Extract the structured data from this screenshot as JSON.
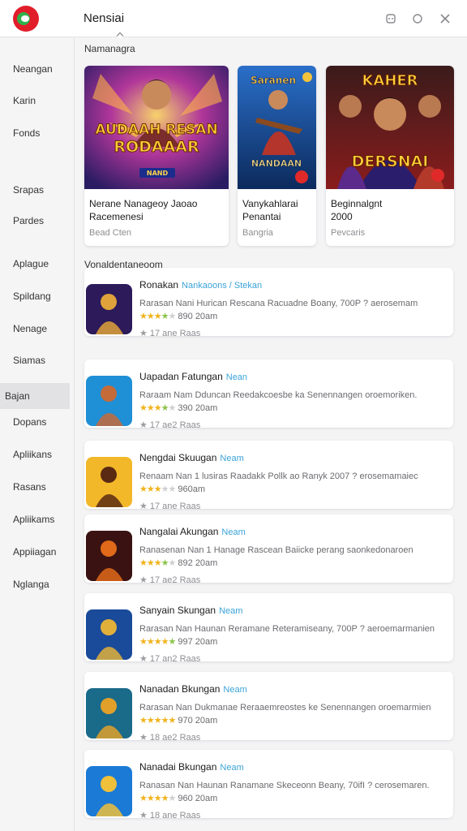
{
  "header": {
    "title": "Nensiai",
    "icons": [
      "gamepad-icon",
      "circle-icon",
      "close-icon"
    ]
  },
  "sidebar": {
    "items": [
      {
        "label": "Neangan",
        "active": false
      },
      {
        "label": "Karin",
        "active": false
      },
      {
        "label": "Fonds",
        "active": false
      },
      {
        "label": "Srapas",
        "active": false
      },
      {
        "label": "Pardes",
        "active": false
      },
      {
        "label": "Aplague",
        "active": false
      },
      {
        "label": "Spildang",
        "active": false
      },
      {
        "label": "Nenage",
        "active": false
      },
      {
        "label": "Siamas",
        "active": false
      },
      {
        "label": "Bajan",
        "active": true
      },
      {
        "label": "Dopans",
        "active": false
      },
      {
        "label": "Apliikans",
        "active": false
      },
      {
        "label": "Rasans",
        "active": false
      },
      {
        "label": "Apliikams",
        "active": false
      },
      {
        "label": "Appiiagan",
        "active": false
      },
      {
        "label": "Nglanga",
        "active": false
      }
    ]
  },
  "featured": {
    "section_label": "Namanagra",
    "cards": [
      {
        "art_text_1": "AUDAAH RESAN",
        "art_text_2": "RODAAAR",
        "art_badge": "NAND",
        "title_line1": "Nerane Nanageoy Jaoao",
        "title_line2": "Racemenesi",
        "category": "Bead Cten"
      },
      {
        "art_text_1": "Saranen",
        "art_text_2": "NANDAAN",
        "art_badge": "",
        "title_line1": "Vanykahlarai",
        "title_line2": "Penantai",
        "category": "Bangria"
      },
      {
        "art_text_1": "KAHER",
        "art_text_2": "DERSNAI",
        "art_badge": "",
        "title_line1": "Beginnalgnt",
        "title_line2": "2000",
        "category": "Pevcaris"
      }
    ]
  },
  "list": {
    "section_label": "Vonaldentaneoom",
    "items": [
      {
        "title": "Ronakan",
        "tag": "Nankaoons / Stekan",
        "desc": "Rarasan Nani Hurican Rescana Racuadne Boany, 700P ? aerosemam",
        "rating_text": "890 20am",
        "downloads": "17 ane Raas",
        "stars_full": 3,
        "stars_half": 1
      },
      {
        "title": "Uapadan Fatungan",
        "tag": "Nean",
        "desc": "Raraam Nam Dduncan Reedakcoesbe ka Senennangen oroemoriken.",
        "rating_text": "390 20am",
        "downloads": "17 ae2 Raas",
        "stars_full": 3,
        "stars_half": 1
      },
      {
        "title": "Nengdai Skuugan",
        "tag": "Neam",
        "desc": "Renaam Nan 1 lusiras Raadakk Pollk ao Ranyk 2007 ? erosemamaiec",
        "rating_text": "960am",
        "downloads": "17 ane Raas",
        "stars_full": 3,
        "stars_half": 0
      },
      {
        "title": "Nangalai Akungan",
        "tag": "Neam",
        "desc": "Ranasenan Nan 1 Hanage Rascean Baiicke perang saonkedonaroen",
        "rating_text": "892 20am",
        "downloads": "17 ae2 Raas",
        "stars_full": 3,
        "stars_half": 1
      },
      {
        "title": "Sanyain Skungan",
        "tag": "Neam",
        "desc": "Rarasan Nan Haunan Reramane Reteramiseany, 700P ? aeroemarmanien",
        "rating_text": "997 20am",
        "downloads": "17 an2 Raas",
        "stars_full": 4,
        "stars_half": 1
      },
      {
        "title": "Nanadan Bkungan",
        "tag": "Neam",
        "desc": "Rarasan Nan Dukmanae Reraaemreostes ke Senennangen oroemarmien",
        "rating_text": "970 20am",
        "downloads": "18 ae2 Raas",
        "stars_full": 5,
        "stars_half": 0
      },
      {
        "title": "Nanadai Bkungan",
        "tag": "Neam",
        "desc": "Ranasan Nan Haunan Ranamane Skeceonn Beany, 70ifI ? cerosemaren.",
        "rating_text": "960 20am",
        "downloads": "18 ane Raas",
        "stars_full": 4,
        "stars_half": 0
      }
    ]
  },
  "colors": {
    "accent_red": "#e11d2a",
    "accent_green": "#2fb24a",
    "tag_blue": "#3aa3d8",
    "star_gold": "#f1b31c"
  }
}
